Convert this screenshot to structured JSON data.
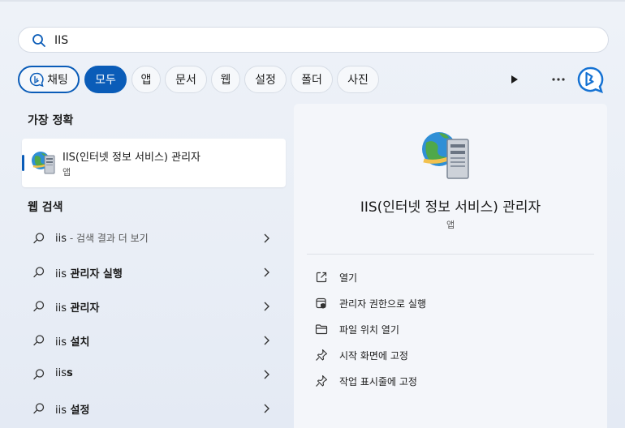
{
  "search": {
    "value": "IIS"
  },
  "filters": {
    "chat": "채팅",
    "all": "모두",
    "apps": "앱",
    "documents": "문서",
    "web": "웹",
    "settings": "설정",
    "folders": "폴더",
    "photos": "사진"
  },
  "best_match": {
    "heading": "가장 정확",
    "title": "IIS(인터넷 정보 서비스) 관리자",
    "type": "앱"
  },
  "web_search": {
    "heading": "웹 검색",
    "items": [
      {
        "query": "iis",
        "suffix": " - 검색 결과 더 보기"
      },
      {
        "query": "iis",
        "suffix": " 관리자 실행"
      },
      {
        "query": "iis",
        "suffix": " 관리자"
      },
      {
        "query": "iis",
        "suffix": " 설치"
      },
      {
        "query": "iis",
        "suffix": "s"
      },
      {
        "query": "iis",
        "suffix": " 설정"
      }
    ]
  },
  "detail": {
    "title": "IIS(인터넷 정보 서비스) 관리자",
    "type": "앱",
    "actions": [
      {
        "label": "열기",
        "icon": "open-icon"
      },
      {
        "label": "관리자 권한으로 실행",
        "icon": "run-as-admin-icon"
      },
      {
        "label": "파일 위치 열기",
        "icon": "folder-icon"
      },
      {
        "label": "시작 화면에 고정",
        "icon": "pin-icon"
      },
      {
        "label": "작업 표시줄에 고정",
        "icon": "pin-icon"
      }
    ]
  },
  "colors": {
    "accent": "#0a5cb8",
    "panel": "#f4f6fa"
  }
}
